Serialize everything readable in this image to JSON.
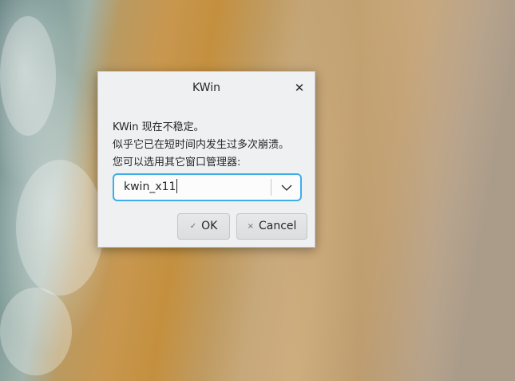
{
  "dialog": {
    "title": "KWin",
    "close_icon": "✕",
    "message_lines": [
      "KWin 现在不稳定。",
      "似乎它已在短时间内发生过多次崩溃。",
      "您可以选用其它窗口管理器:"
    ],
    "window_manager_select": {
      "value": "kwin_x11",
      "arrow_icon": "chevron-down-icon"
    },
    "buttons": {
      "ok_label": "OK",
      "ok_icon": "✓",
      "cancel_label": "Cancel",
      "cancel_icon": "×"
    }
  },
  "colors": {
    "dialog_background": "#eff0f1",
    "focus_accent": "#3daee9",
    "text": "#232627"
  }
}
